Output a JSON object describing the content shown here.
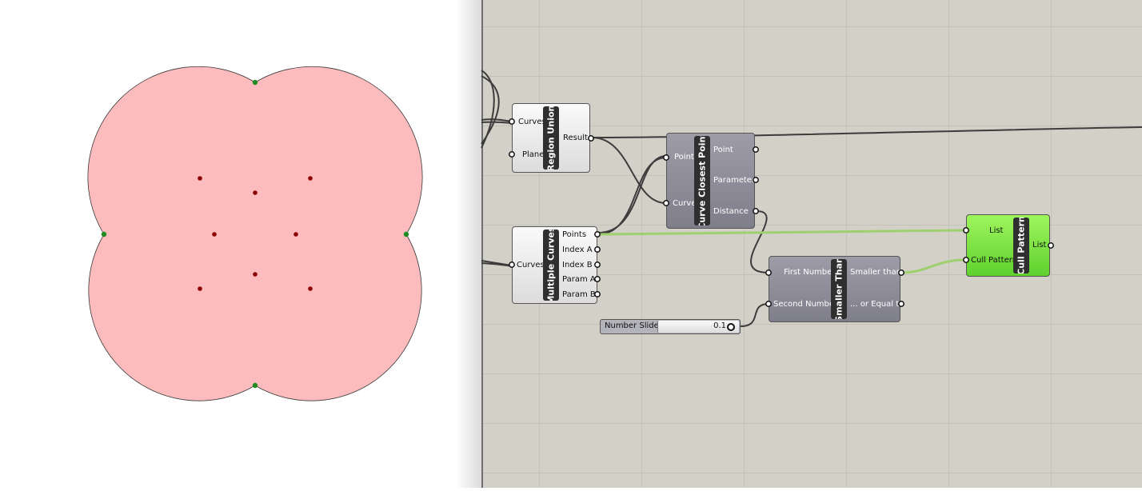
{
  "components": {
    "region_union": {
      "title": "Region Union",
      "inputs": [
        "Curves",
        "Plane"
      ],
      "outputs": [
        "Result"
      ]
    },
    "multiple_curves": {
      "title": "Multiple Curves",
      "inputs": [
        "Curves"
      ],
      "outputs": [
        "Points",
        "Index A",
        "Index B",
        "Param A",
        "Param B"
      ]
    },
    "curve_closest_point": {
      "title": "Curve Closest Point",
      "inputs": [
        "Point",
        "Curve"
      ],
      "outputs": [
        "Point",
        "Parameter",
        "Distance"
      ]
    },
    "smaller_than": {
      "title": "Smaller Than",
      "inputs": [
        "First Number",
        "Second Number"
      ],
      "outputs": [
        "Smaller than",
        "... or Equal to"
      ]
    },
    "cull_pattern": {
      "title": "Cull Pattern",
      "inputs": [
        "List",
        "Cull Pattern"
      ],
      "outputs": [
        "List"
      ]
    },
    "number_slider": {
      "label": "Number Slider",
      "value": "0.1"
    }
  },
  "colors": {
    "region_fill": "#fcbcbd",
    "intersection_point": "#228b22",
    "closest_point": "#8b0000",
    "canvas": "#d3d0c8",
    "wire": "#3c3c3c",
    "selected_wire": "#9ed06f",
    "cull_pattern_fill": "#7ee145"
  }
}
